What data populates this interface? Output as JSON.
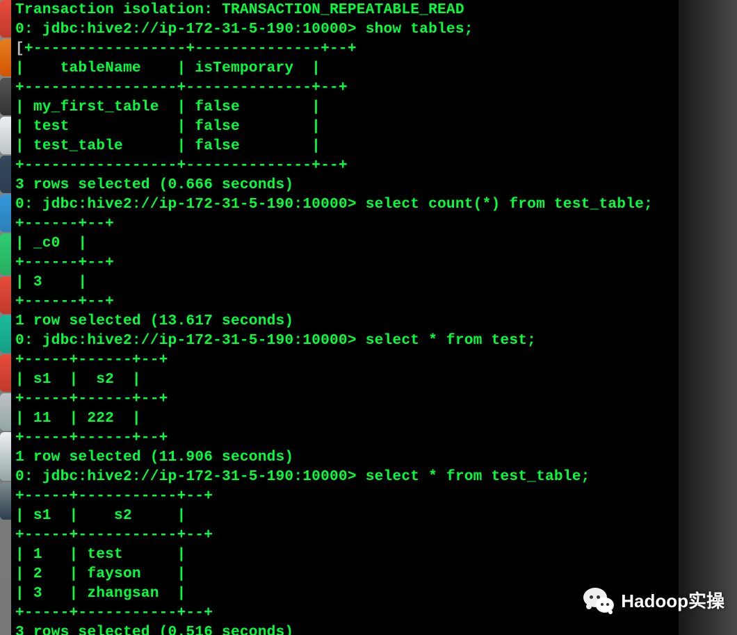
{
  "terminal": {
    "isolation_line": "Transaction isolation: TRANSACTION_REPEATABLE_READ",
    "prompt": "0: jdbc:hive2://ip-172-31-5-190:10000>",
    "bracket": "[",
    "commands": {
      "show_tables": "show tables;",
      "count_test_table": "select count(*) from test_table;",
      "select_test": "select * from test;",
      "select_test_table": "select * from test_table;"
    },
    "result_tables": {
      "show_tables": {
        "border": "+-----------------+--------------+--+",
        "header": "|    tableName    | isTemporary  |",
        "rows": [
          "| my_first_table  | false        |",
          "| test            | false        |",
          "| test_table      | false        |"
        ],
        "footer": "3 rows selected (0.666 seconds)"
      },
      "count": {
        "border": "+------+--+",
        "header": "| _c0  |",
        "rows": [
          "| 3    |"
        ],
        "footer": "1 row selected (13.617 seconds)"
      },
      "test": {
        "border": "+-----+------+--+",
        "header": "| s1  |  s2  |",
        "rows": [
          "| 11  | 222  |"
        ],
        "footer": "1 row selected (11.906 seconds)"
      },
      "test_table": {
        "border": "+-----+-----------+--+",
        "header": "| s1  |    s2     |",
        "rows": [
          "| 1   | test      |",
          "| 2   | fayson    |",
          "| 3   | zhangsan  |"
        ],
        "footer": "3 rows selected (0.516 seconds)"
      }
    }
  },
  "watermark": {
    "text": "Hadoop实操",
    "icon": "wechat-icon"
  }
}
